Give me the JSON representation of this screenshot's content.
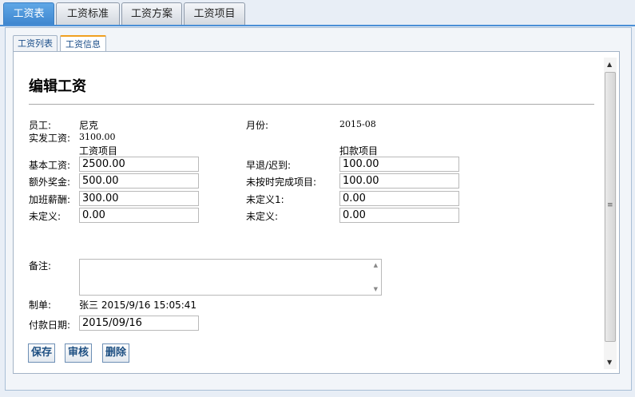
{
  "top_tabs": [
    {
      "label": "工资表",
      "active": true
    },
    {
      "label": "工资标准",
      "active": false
    },
    {
      "label": "工资方案",
      "active": false
    },
    {
      "label": "工资项目",
      "active": false
    }
  ],
  "sub_tabs": [
    {
      "label": "工资列表",
      "active": false
    },
    {
      "label": "工资信息",
      "active": true
    }
  ],
  "form": {
    "title": "编辑工资",
    "employee_label": "员工:",
    "employee_value": "尼克",
    "month_label": "月份:",
    "month_value": "2015-08",
    "actual_pay_label": "实发工资:",
    "actual_pay_value": "3100.00",
    "salary_items_heading": "工资项目",
    "deduction_items_heading": "扣款项目",
    "salary_items": [
      {
        "label": "基本工资:",
        "value": "2500.00"
      },
      {
        "label": "额外奖金:",
        "value": "500.00"
      },
      {
        "label": "加班薪酬:",
        "value": "300.00"
      },
      {
        "label": "未定义:",
        "value": "0.00"
      }
    ],
    "deduction_items": [
      {
        "label": "早退/迟到:",
        "value": "100.00"
      },
      {
        "label": "未按时完成项目:",
        "value": "100.00"
      },
      {
        "label": "未定义1:",
        "value": "0.00"
      },
      {
        "label": "未定义:",
        "value": "0.00"
      }
    ],
    "remark_label": "备注:",
    "remark_value": "",
    "creator_label": "制单:",
    "creator_value": "张三 2015/9/16 15:05:41",
    "payment_date_label": "付款日期:",
    "payment_date_value": "2015/09/16"
  },
  "buttons": {
    "save": "保存",
    "review": "审核",
    "delete": "删除"
  },
  "icons": {
    "scroll_up": "up-arrow-icon",
    "scroll_down": "down-arrow-icon"
  },
  "colors": {
    "active_tab": "#3e86cf",
    "active_subtab_accent": "#f0a020",
    "button_text": "#1d4f82"
  }
}
